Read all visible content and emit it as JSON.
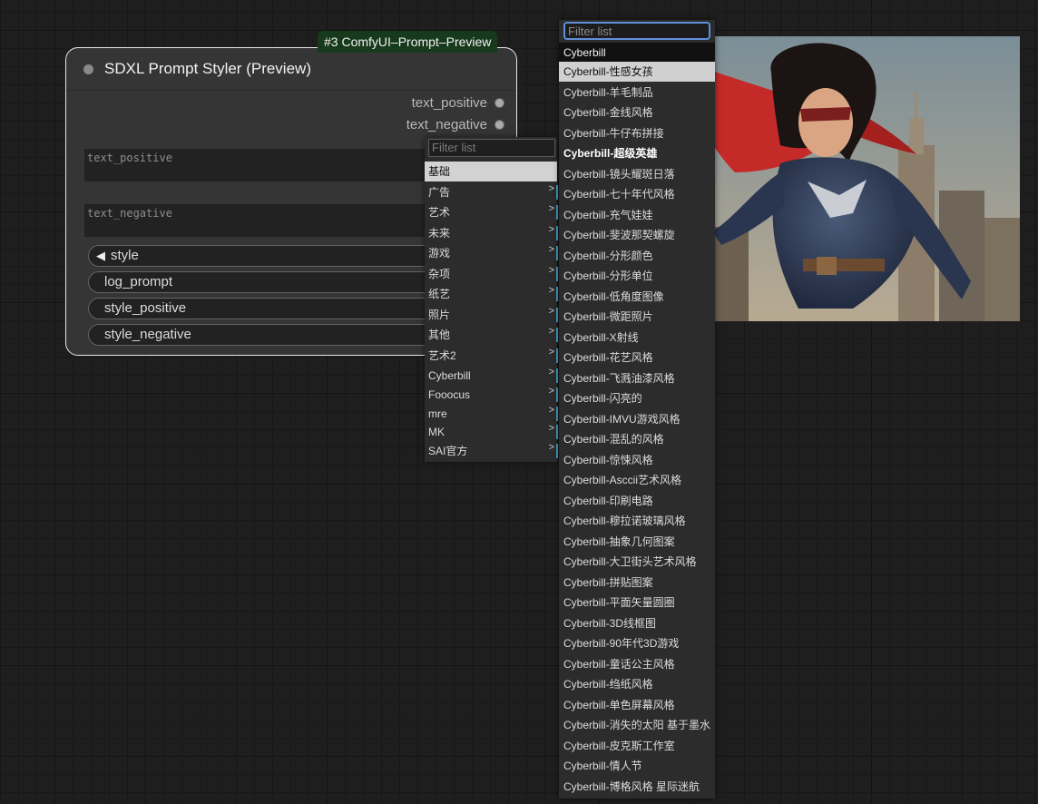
{
  "node": {
    "badge": "#3 ComfyUI–Prompt–Preview",
    "title": "SDXL Prompt Styler (Preview)",
    "outputs": [
      "text_positive",
      "text_negative"
    ],
    "textareas": [
      "text_positive",
      "text_negative"
    ],
    "widgets": [
      {
        "label": "style",
        "has_arrow": true
      },
      {
        "label": "log_prompt",
        "has_arrow": false
      },
      {
        "label": "style_positive",
        "has_arrow": false
      },
      {
        "label": "style_negative",
        "has_arrow": false
      }
    ]
  },
  "category_menu": {
    "filter_placeholder": "Filter list",
    "items": [
      "基础",
      "广告",
      "艺术",
      "未来",
      "游戏",
      "杂项",
      "纸艺",
      "照片",
      "其他",
      "艺术2",
      "Cyberbill",
      "Fooocus",
      "mre",
      "MK",
      "SAI官方"
    ],
    "selected": "基础"
  },
  "style_menu": {
    "filter_placeholder": "Filter list",
    "header": "Cyberbill",
    "selected": "Cyberbill-性感女孩",
    "hovered": "Cyberbill-超级英雄",
    "items": [
      "Cyberbill-性感女孩",
      "Cyberbill-羊毛制品",
      "Cyberbill-金线风格",
      "Cyberbill-牛仔布拼接",
      "Cyberbill-超级英雄",
      "Cyberbill-镜头耀斑日落",
      "Cyberbill-七十年代风格",
      "Cyberbill-充气娃娃",
      "Cyberbill-斐波那契螺旋",
      "Cyberbill-分形颜色",
      "Cyberbill-分形单位",
      "Cyberbill-低角度图像",
      "Cyberbill-微距照片",
      "Cyberbill-X射线",
      "Cyberbill-花艺风格",
      "Cyberbill-飞溅油漆风格",
      "Cyberbill-闪亮的",
      "Cyberbill-IMVU游戏风格",
      "Cyberbill-混乱的风格",
      "Cyberbill-惊悚风格",
      "Cyberbill-Asccii艺术风格",
      "Cyberbill-印刷电路",
      "Cyberbill-穆拉诺玻璃风格",
      "Cyberbill-抽象几何图案",
      "Cyberbill-大卫街头艺术风格",
      "Cyberbill-拼贴图案",
      "Cyberbill-平面矢量圆圈",
      "Cyberbill-3D线框图",
      "Cyberbill-90年代3D游戏",
      "Cyberbill-童话公主风格",
      "Cyberbill-绉纸风格",
      "Cyberbill-单色屏幕风格",
      "Cyberbill-消失的太阳 基于墨水",
      "Cyberbill-皮克斯工作室",
      "Cyberbill-情人节",
      "Cyberbill-博格风格 星际迷航"
    ]
  },
  "colors": {
    "accent": "#3aa3d0",
    "badge_bg": "#183a1c",
    "filter_focus": "#5e8fd9"
  }
}
